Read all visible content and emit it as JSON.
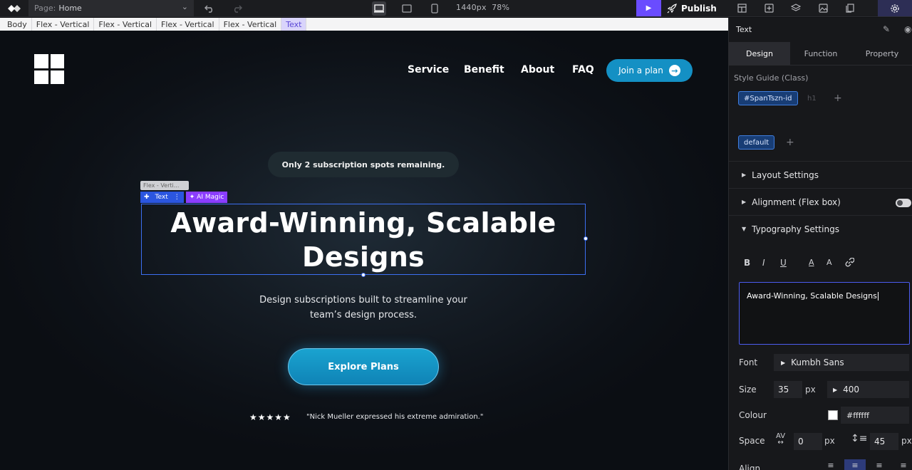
{
  "toolbar": {
    "page_prefix": "Page:",
    "page_name": "Home",
    "viewport": "1440px",
    "zoom": "78%",
    "publish_label": "Publish"
  },
  "breadcrumb": [
    "Body",
    "Flex - Vertical",
    "Flex - Vertical",
    "Flex - Vertical",
    "Flex - Vertical",
    "Text"
  ],
  "site": {
    "nav": [
      "Service",
      "Benefit",
      "About",
      "FAQ"
    ],
    "join_label": "Join a plan",
    "spots_text": "Only 2 subscription spots remaining.",
    "selection_parent": "Flex - Verti...",
    "selection_label": "Text",
    "ai_label": "AI Magic",
    "hero_title": "Award-Winning, Scalable Designs",
    "subtitle_line1": "Design subscriptions built to streamline your",
    "subtitle_line2": "team’s design process.",
    "cta_label": "Explore Plans",
    "stars": "★★★★★",
    "quote": "\"Nick Mueller expressed his extreme admiration.\""
  },
  "panel": {
    "title": "Text",
    "tabs": [
      "Design",
      "Function",
      "Property"
    ],
    "style_guide_label": "Style Guide (Class)",
    "class_chip": "#SpanTszn-id",
    "class_tag": "h1",
    "state_chip": "default",
    "sections": {
      "layout": "Layout Settings",
      "alignment": "Alignment (Flex box)",
      "typography": "Typography Settings"
    },
    "fmt_buttons": [
      "B",
      "I",
      "U",
      "A",
      "A"
    ],
    "text_value": "Award-Winning, Scalable Designs",
    "font_label": "Font",
    "font_value": "Kumbh Sans",
    "size_label": "Size",
    "size_value": "35",
    "size_unit": "px",
    "weight_value": "400",
    "colour_label": "Colour",
    "colour_value": "#ffffff",
    "space_label": "Space",
    "letter_spacing": "0",
    "letter_unit": "px",
    "line_height": "45",
    "line_unit": "px",
    "align_label": "Align"
  }
}
